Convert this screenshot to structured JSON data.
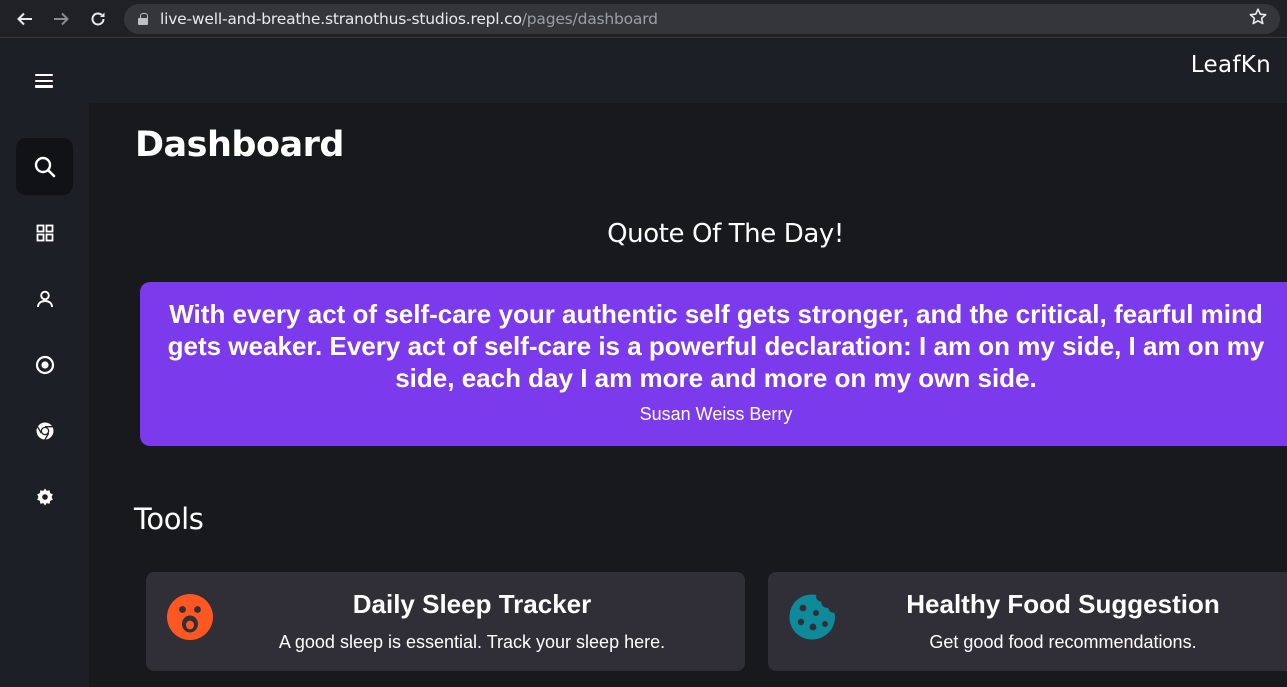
{
  "browser": {
    "url_host": "live-well-and-breathe.stranothus-studios.repl.co",
    "url_path": "/pages/dashboard",
    "back_icon": "arrow-left-icon",
    "forward_icon": "arrow-right-icon",
    "reload_icon": "reload-icon",
    "bookmark_icon": "star-icon"
  },
  "header": {
    "brand": "LeafKn",
    "menu_icon": "hamburger-icon"
  },
  "sidebar": {
    "items": [
      {
        "icon": "search-icon",
        "active": true
      },
      {
        "icon": "grid-icon",
        "active": false
      },
      {
        "icon": "user-icon",
        "active": false
      },
      {
        "icon": "target-icon",
        "active": false
      },
      {
        "icon": "chrome-icon",
        "active": false
      },
      {
        "icon": "gear-icon",
        "active": false
      }
    ]
  },
  "main": {
    "title": "Dashboard",
    "quote_heading": "Quote Of The Day!",
    "quote": {
      "text": "With every act of self-care your authentic self gets stronger, and the critical, fearful mind gets weaker. Every act of self-care is a powerful declaration: I am on my side, I am on my side, each day I am more and more on my own side.",
      "author": "Susan Weiss Berry",
      "bg_color": "#7c3aed"
    },
    "tools_heading": "Tools",
    "tools": [
      {
        "title": "Daily Sleep Tracker",
        "description": "A good sleep is essential. Track your sleep here.",
        "icon": "surprised-face-icon",
        "icon_color": "#ff5722"
      },
      {
        "title": "Healthy Food Suggestion",
        "description": "Get good food recommendations.",
        "icon": "cookie-icon",
        "icon_color": "#0e8a9a"
      }
    ]
  }
}
